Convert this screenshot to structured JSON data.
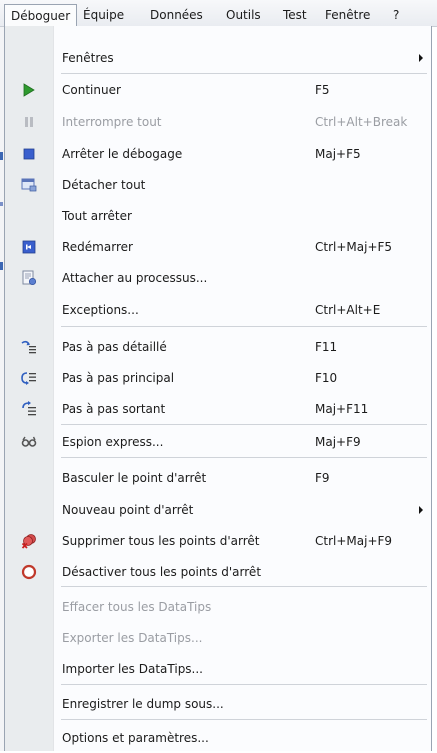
{
  "menubar": {
    "items": [
      {
        "label": "Déboguer"
      },
      {
        "label": "Équipe"
      },
      {
        "label": "Données"
      },
      {
        "label": "Outils"
      },
      {
        "label": "Test"
      },
      {
        "label": "Fenêtre"
      },
      {
        "label": "?"
      }
    ]
  },
  "menu": {
    "items": [
      {
        "label": "Fenêtres",
        "shortcut": "",
        "icon": "none",
        "submenu": true,
        "disabled": false
      },
      {
        "label": "Continuer",
        "shortcut": "F5",
        "icon": "play-icon",
        "submenu": false,
        "disabled": false
      },
      {
        "label": "Interrompre tout",
        "shortcut": "Ctrl+Alt+Break",
        "icon": "pause-icon",
        "submenu": false,
        "disabled": true
      },
      {
        "label": "Arrêter le débogage",
        "shortcut": "Maj+F5",
        "icon": "stop-icon",
        "submenu": false,
        "disabled": false
      },
      {
        "label": "Détacher tout",
        "shortcut": "",
        "icon": "detach-icon",
        "submenu": false,
        "disabled": false
      },
      {
        "label": "Tout arrêter",
        "shortcut": "",
        "icon": "none",
        "submenu": false,
        "disabled": false
      },
      {
        "label": "Redémarrer",
        "shortcut": "Ctrl+Maj+F5",
        "icon": "restart-icon",
        "submenu": false,
        "disabled": false
      },
      {
        "label": "Attacher au processus...",
        "shortcut": "",
        "icon": "attach-process-icon",
        "submenu": false,
        "disabled": false
      },
      {
        "label": "Exceptions...",
        "shortcut": "Ctrl+Alt+E",
        "icon": "none",
        "submenu": false,
        "disabled": false
      },
      {
        "label": "Pas à pas détaillé",
        "shortcut": "F11",
        "icon": "step-into-icon",
        "submenu": false,
        "disabled": false
      },
      {
        "label": "Pas à pas principal",
        "shortcut": "F10",
        "icon": "step-over-icon",
        "submenu": false,
        "disabled": false
      },
      {
        "label": "Pas à pas sortant",
        "shortcut": "Maj+F11",
        "icon": "step-out-icon",
        "submenu": false,
        "disabled": false
      },
      {
        "label": "Espion express...",
        "shortcut": "Maj+F9",
        "icon": "quickwatch-icon",
        "submenu": false,
        "disabled": false
      },
      {
        "label": "Basculer le point d'arrêt",
        "shortcut": "F9",
        "icon": "none",
        "submenu": false,
        "disabled": false
      },
      {
        "label": "Nouveau point d'arrêt",
        "shortcut": "",
        "icon": "none",
        "submenu": true,
        "disabled": false
      },
      {
        "label": "Supprimer tous les points d'arrêt",
        "shortcut": "Ctrl+Maj+F9",
        "icon": "delete-breakpoints-icon",
        "submenu": false,
        "disabled": false
      },
      {
        "label": "Désactiver tous les points d'arrêt",
        "shortcut": "",
        "icon": "disable-breakpoints-icon",
        "submenu": false,
        "disabled": false
      },
      {
        "label": "Effacer tous les DataTips",
        "shortcut": "",
        "icon": "none",
        "submenu": false,
        "disabled": true
      },
      {
        "label": "Exporter les DataTips...",
        "shortcut": "",
        "icon": "none",
        "submenu": false,
        "disabled": true
      },
      {
        "label": "Importer les DataTips...",
        "shortcut": "",
        "icon": "none",
        "submenu": false,
        "disabled": false
      },
      {
        "label": "Enregistrer le dump sous...",
        "shortcut": "",
        "icon": "none",
        "submenu": false,
        "disabled": false
      },
      {
        "label": "Options et paramètres...",
        "shortcut": "",
        "icon": "none",
        "submenu": false,
        "disabled": false
      }
    ]
  },
  "colors": {
    "gutter": "#e9ecee",
    "separator": "#cfd3d9",
    "disabled_text": "#9a9da3",
    "play_green": "#2e9a2e",
    "stop_blue": "#3a5fcd"
  }
}
